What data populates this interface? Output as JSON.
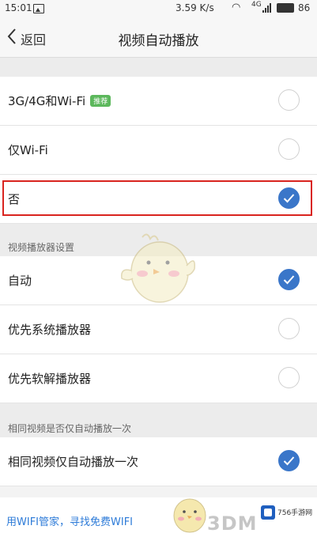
{
  "status_bar": {
    "time": "15:01",
    "network_speed": "3.59 K/s",
    "signal_type": "4G",
    "battery_level": "86"
  },
  "header": {
    "back_label": "返回",
    "title": "视频自动播放"
  },
  "autoplay_options": [
    {
      "label": "3G/4G和Wi-Fi",
      "badge": "推荐",
      "checked": false
    },
    {
      "label": "仅Wi-Fi",
      "checked": false
    },
    {
      "label": "否",
      "checked": true
    }
  ],
  "player_settings": {
    "section_title": "视频播放器设置",
    "options": [
      {
        "label": "自动",
        "checked": true
      },
      {
        "label": "优先系统播放器",
        "checked": false
      },
      {
        "label": "优先软解播放器",
        "checked": false
      }
    ]
  },
  "same_video": {
    "section_title": "相同视频是否仅自动播放一次",
    "option": {
      "label": "相同视频仅自动播放一次",
      "checked": true
    }
  },
  "banner": {
    "text": "用WIFI管家，寻找免费WIFI",
    "watermark": "3DM",
    "logo_text": "756手游网"
  },
  "colors": {
    "accent": "#3a76c9",
    "highlight": "#d9241f",
    "badge": "#5cb85c"
  }
}
